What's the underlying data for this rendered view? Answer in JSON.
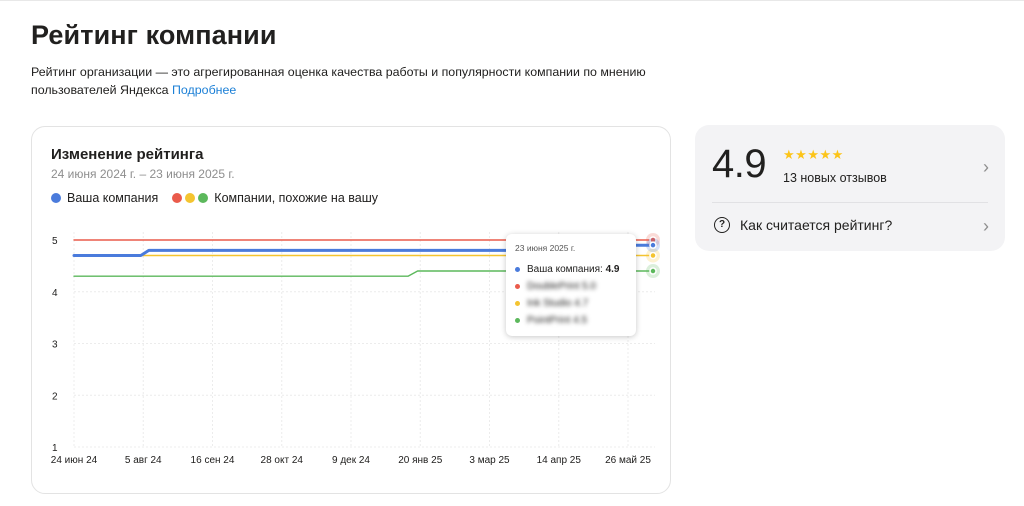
{
  "page": {
    "title": "Рейтинг компании",
    "subtitle": "Рейтинг организации — это агрегированная оценка качества работы и популярности компании по мнению пользователей Яндекса",
    "more_link": "Подробнее"
  },
  "chart_card": {
    "title": "Изменение рейтинга",
    "period": "24 июня 2024 г. – 23 июня 2025 г.",
    "legend_own": "Ваша компания",
    "legend_similar": "Компании, похожие на вашу"
  },
  "tooltip": {
    "date": "23 июня 2025 г.",
    "own_label": "Ваша компания:",
    "own_value": "4.9",
    "competitor_1": "DoublePrint 5.0",
    "competitor_2": "Ink Studio 4.7",
    "competitor_3": "PointPrint 4.5"
  },
  "summary": {
    "rating": "4.9",
    "stars": 5,
    "reviews": "13 новых отзывов",
    "how_calculated": "Как считается рейтинг?"
  },
  "colors": {
    "own": "#4a7bdc",
    "red": "#ea5b4b",
    "yellow": "#f4c430",
    "green": "#5cb85c",
    "link": "#1b7fd6"
  },
  "chart_data": {
    "type": "line",
    "x_labels": [
      "24 июн 24",
      "5 авг 24",
      "16 сен 24",
      "28 окт 24",
      "9 дек 24",
      "20 янв 25",
      "3 мар 25",
      "14 апр 25",
      "26 май 25"
    ],
    "y_ticks": [
      1,
      2,
      3,
      4,
      5
    ],
    "ylim": [
      1,
      5
    ],
    "xlim": [
      "2024-06-24",
      "2025-06-23"
    ],
    "series": [
      {
        "name": "Ваша компания",
        "color": "#4a7bdc",
        "points": [
          [
            "2024-06-24",
            4.7
          ],
          [
            "2024-08-05",
            4.7
          ],
          [
            "2024-08-10",
            4.8
          ],
          [
            "2025-05-20",
            4.8
          ],
          [
            "2025-05-25",
            4.9
          ],
          [
            "2025-06-23",
            4.9
          ]
        ]
      },
      {
        "color": "#ea5b4b",
        "points": [
          [
            "2024-06-24",
            5.0
          ],
          [
            "2025-06-23",
            5.0
          ]
        ]
      },
      {
        "color": "#f4c430",
        "points": [
          [
            "2024-06-24",
            4.7
          ],
          [
            "2025-06-23",
            4.7
          ]
        ]
      },
      {
        "color": "#5cb85c",
        "points": [
          [
            "2024-06-24",
            4.3
          ],
          [
            "2025-01-20",
            4.3
          ],
          [
            "2025-01-26",
            4.4
          ],
          [
            "2025-06-23",
            4.4
          ]
        ]
      }
    ]
  }
}
